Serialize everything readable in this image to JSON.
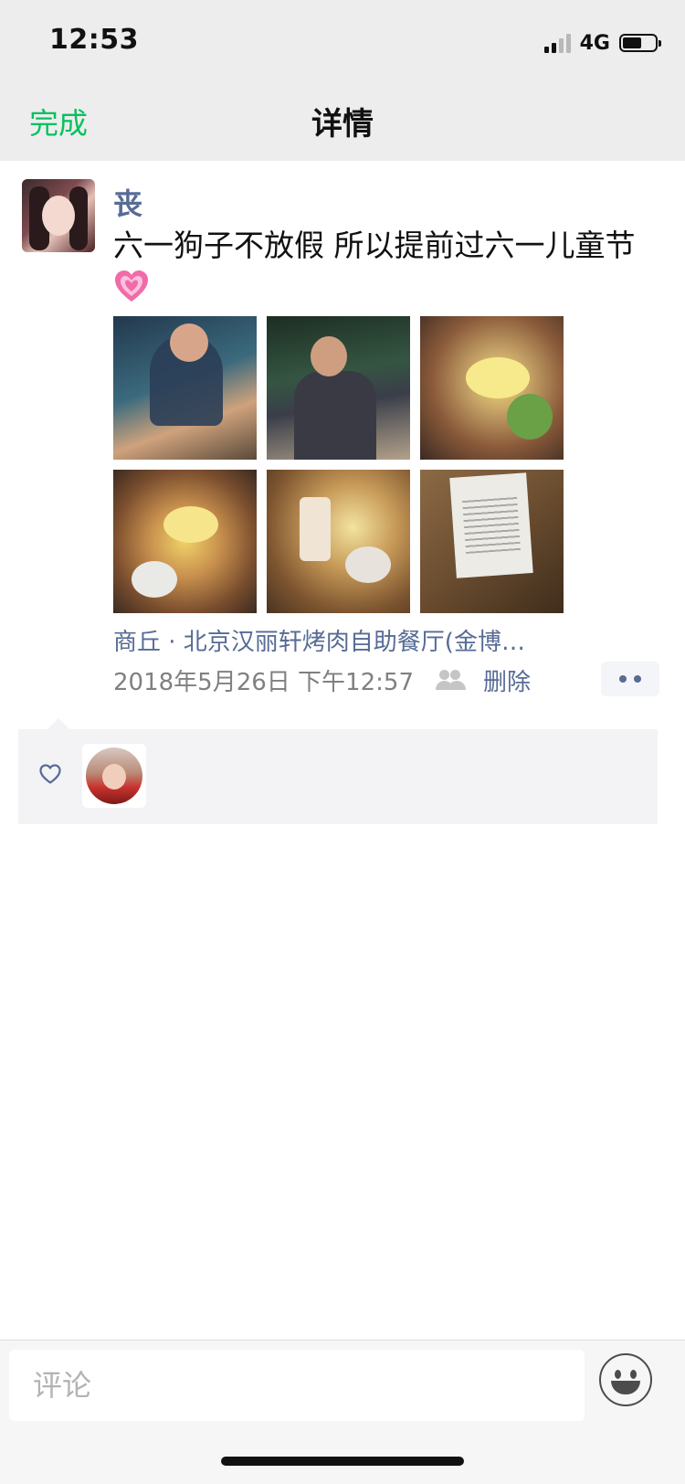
{
  "status_bar": {
    "time": "12:53",
    "network": "4G"
  },
  "nav": {
    "done_label": "完成",
    "title": "详情"
  },
  "post": {
    "username": "丧",
    "text": "六一狗子不放假 所以提前过六一儿童节",
    "emoji": "💗",
    "photos": [
      "photo-person-1",
      "photo-person-2",
      "photo-food-1",
      "photo-food-2",
      "photo-food-3",
      "photo-receipt"
    ],
    "location": "商丘 · 北京汉丽轩烤肉自助餐厅(金博…",
    "timestamp": "2018年5月26日 下午12:57",
    "delete_label": "删除"
  },
  "likes": {
    "icon": "heart-outline-icon",
    "count": 1
  },
  "comment": {
    "placeholder": "评论"
  },
  "colors": {
    "accent_green": "#07c160",
    "link_blue": "#576b95"
  }
}
